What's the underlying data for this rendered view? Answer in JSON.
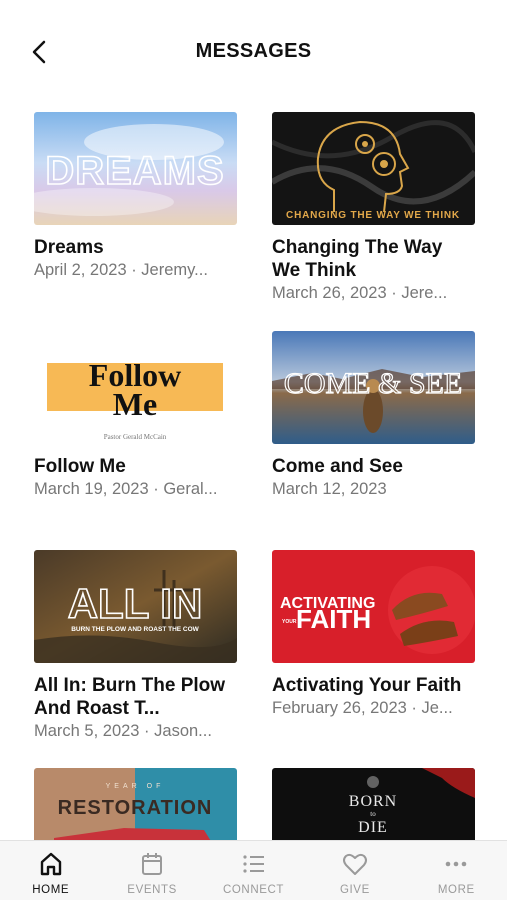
{
  "header": {
    "title": "MESSAGES",
    "back_icon": "chevron-left-icon"
  },
  "messages": [
    {
      "title": "Dreams",
      "subtitle": "April 2, 2023 · Jeremy...",
      "art_text": "DREAMS"
    },
    {
      "title": "Changing The Way We Think",
      "subtitle": "March 26, 2023 · Jere...",
      "art_text": "CHANGING THE WAY WE THINK"
    },
    {
      "title": "Follow Me",
      "subtitle": "March 19, 2023 · Geral...",
      "art_text": "Follow Me",
      "art_subtext": "Pastor Gerald McCain"
    },
    {
      "title": "Come and See",
      "subtitle": "March 12, 2023",
      "art_text": "COME & SEE"
    },
    {
      "title": "All In: Burn The Plow And Roast T...",
      "subtitle": "March 5, 2023 · Jason...",
      "art_text": "ALL IN",
      "art_subtext": "BURN THE PLOW AND ROAST THE COW"
    },
    {
      "title": "Activating Your Faith",
      "subtitle": "February 26, 2023 · Je...",
      "art_text": "ACTIVATING",
      "art_text2": "FAITH",
      "art_small": "YOUR"
    },
    {
      "title": "",
      "subtitle": "",
      "art_text": "RESTORATION",
      "art_small": "YEAR OF"
    },
    {
      "title": "",
      "subtitle": "",
      "art_text": "BORN",
      "art_text2": "DIE",
      "art_small": "to"
    }
  ],
  "tabs": [
    {
      "label": "HOME",
      "icon": "home-icon",
      "active": true
    },
    {
      "label": "EVENTS",
      "icon": "calendar-icon",
      "active": false
    },
    {
      "label": "CONNECT",
      "icon": "list-icon",
      "active": false
    },
    {
      "label": "GIVE",
      "icon": "heart-icon",
      "active": false
    },
    {
      "label": "MORE",
      "icon": "more-icon",
      "active": false
    }
  ],
  "colors": {
    "active_tab": "#111111",
    "inactive_tab": "#9a9a9a",
    "activating_red": "#d81f2a",
    "follow_yellow": "#f7b955"
  }
}
